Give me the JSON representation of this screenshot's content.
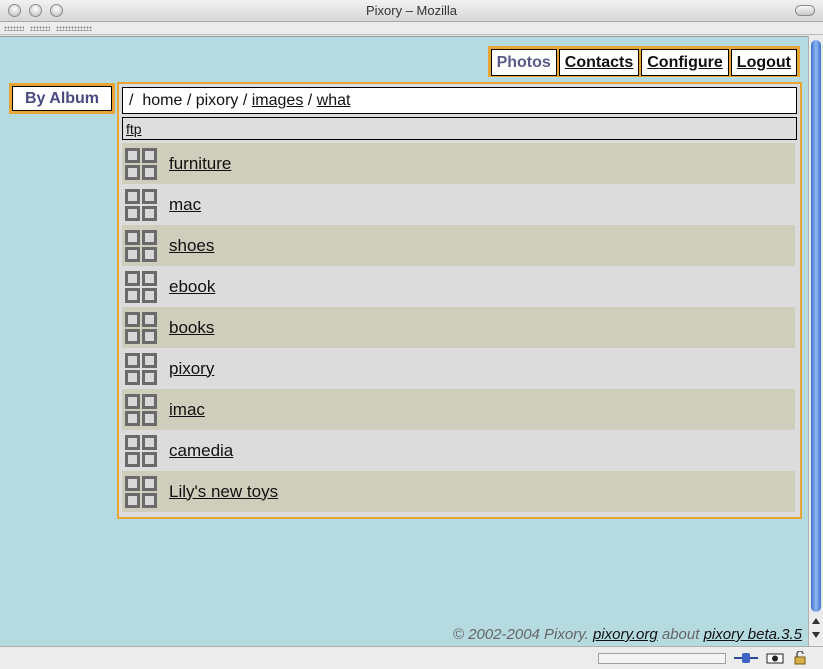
{
  "window": {
    "title": "Pixory – Mozilla"
  },
  "nav": {
    "tabs": [
      {
        "label": "Photos",
        "active": true
      },
      {
        "label": "Contacts",
        "active": false
      },
      {
        "label": "Configure",
        "active": false
      },
      {
        "label": "Logout",
        "active": false
      }
    ]
  },
  "sidebar": {
    "by_album": "By Album"
  },
  "breadcrumb": {
    "root": "/",
    "home": "home",
    "pixory": "pixory",
    "images": "images",
    "what": "what"
  },
  "ftp": {
    "label": "ftp"
  },
  "albums": [
    {
      "label": "furniture"
    },
    {
      "label": "mac"
    },
    {
      "label": "shoes"
    },
    {
      "label": "ebook"
    },
    {
      "label": "books"
    },
    {
      "label": "pixory"
    },
    {
      "label": "imac"
    },
    {
      "label": "camedia"
    },
    {
      "label": "Lily's new toys"
    }
  ],
  "footer": {
    "copyright": "© 2002-2004 Pixory.",
    "site_link": "pixory.org",
    "about": "about",
    "version_link": "pixory beta.3.5"
  },
  "colors": {
    "content_bg": "#b5dbe1",
    "accent_orange": "#e8a434",
    "row_odd": "#cfcebc",
    "row_even": "#dcdcdc"
  },
  "icons": [
    "album-grid-icon",
    "connection-icon",
    "security-lock-icon",
    "eye-icon"
  ]
}
